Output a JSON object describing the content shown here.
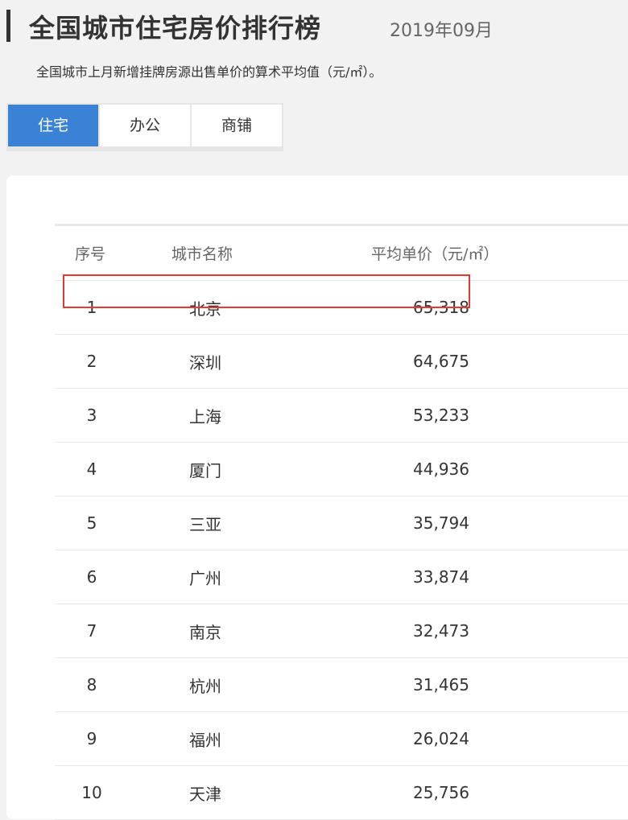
{
  "header": {
    "title": "全国城市住宅房价排行榜",
    "date": "2019年09月",
    "subtitle": "全国城市上月新增挂牌房源出售单价的算术平均值（元/㎡）。"
  },
  "tabs": [
    {
      "label": "住宅",
      "active": true
    },
    {
      "label": "办公",
      "active": false
    },
    {
      "label": "商铺",
      "active": false
    }
  ],
  "table": {
    "headers": {
      "rank": "序号",
      "city": "城市名称",
      "price": "平均单价（元/㎡）"
    },
    "rows": [
      {
        "rank": "1",
        "city": "北京",
        "price": "65,318"
      },
      {
        "rank": "2",
        "city": "深圳",
        "price": "64,675"
      },
      {
        "rank": "3",
        "city": "上海",
        "price": "53,233"
      },
      {
        "rank": "4",
        "city": "厦门",
        "price": "44,936"
      },
      {
        "rank": "5",
        "city": "三亚",
        "price": "35,794"
      },
      {
        "rank": "6",
        "city": "广州",
        "price": "33,874"
      },
      {
        "rank": "7",
        "city": "南京",
        "price": "32,473"
      },
      {
        "rank": "8",
        "city": "杭州",
        "price": "31,465"
      },
      {
        "rank": "9",
        "city": "福州",
        "price": "26,024"
      },
      {
        "rank": "10",
        "city": "天津",
        "price": "25,756"
      }
    ]
  },
  "colors": {
    "tab_active_bg": "#3a82d5",
    "highlight_border": "#e53935"
  }
}
